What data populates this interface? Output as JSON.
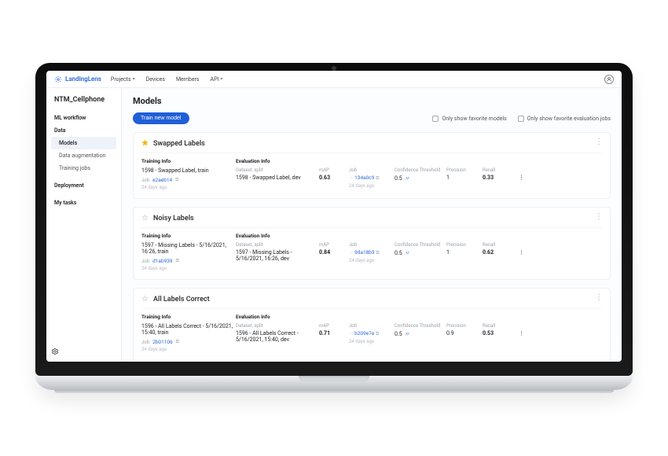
{
  "brand": "LandingLens",
  "nav": {
    "projects": "Projects",
    "devices": "Devices",
    "members": "Members",
    "api": "API"
  },
  "project_name": "NTM_Cellphone",
  "sidebar": {
    "ml_workflow": "ML workflow",
    "data": "Data",
    "models": "Models",
    "data_aug": "Data augmentation",
    "training_jobs": "Training jobs",
    "deployment": "Deployment",
    "my_tasks": "My tasks"
  },
  "page": {
    "title": "Models",
    "train_btn": "Train new model",
    "filter_fav_models": "Only show favorite models",
    "filter_fav_evals": "Only show favorite evaluation jobs"
  },
  "section_labels": {
    "training_info": "Training Info",
    "evaluation_info": "Evaluation Info",
    "dataset_split": "Dataset, split",
    "map": "mAP",
    "job": "Job",
    "conf_thresh": "Confidence Threshold",
    "precision": "Precision",
    "recall": "Recall",
    "job_prefix": "Job"
  },
  "models": [
    {
      "name": "Swapped Labels",
      "favorite": true,
      "training_dataset": "1598 - Swapped Label, train",
      "training_job": "e2aeb14",
      "training_age": "24 days ago",
      "eval_dataset": "1598 - Swapped Label, dev",
      "eval_map": "0.63",
      "eval_job": "134a0c9",
      "eval_job_age": "24 days ago",
      "conf_threshold": "0.5",
      "precision": "1",
      "recall": "0.33"
    },
    {
      "name": "Noisy Labels",
      "favorite": false,
      "training_dataset": "1597 - Missing Labels - 5/16/2021, 16:26, train",
      "training_job": "d1ab939",
      "training_age": "24 days ago",
      "eval_dataset": "1597 - Missing Labels - 5/16/2021, 16:26, dev",
      "eval_map": "0.84",
      "eval_job": "9da18b3",
      "eval_job_age": "24 days ago",
      "conf_threshold": "0.5",
      "precision": "1",
      "recall": "0.62"
    },
    {
      "name": "All Labels Correct",
      "favorite": false,
      "training_dataset": "1596 - All Labels Correct - 5/16/2021, 15:40, train",
      "training_job": "2b01106",
      "training_age": "24 days ago",
      "eval_dataset": "1596 - All Labels Correct - 5/16/2021, 15:40, dev",
      "eval_map": "0.71",
      "eval_job": "b209e7e",
      "eval_job_age": "24 days ago",
      "conf_threshold": "0.5",
      "precision": "0.9",
      "recall": "0.53"
    }
  ]
}
